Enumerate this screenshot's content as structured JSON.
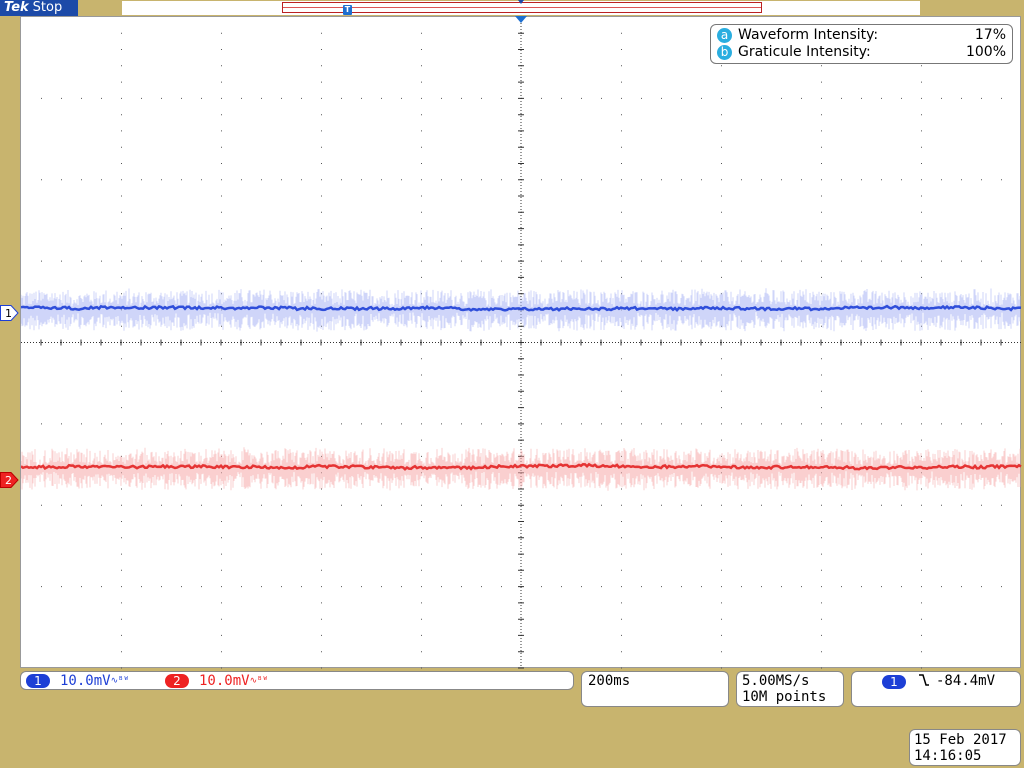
{
  "topbar": {
    "brand": "Tek",
    "state": "Stop",
    "trigger_marker": "T"
  },
  "intensity": {
    "waveform": {
      "key": "a",
      "label": "Waveform Intensity:",
      "value": "17%"
    },
    "graticule": {
      "key": "b",
      "label": "Graticule Intensity:",
      "value": "100%"
    }
  },
  "channel_markers": {
    "ch1": "1",
    "ch2": "2"
  },
  "channels": [
    {
      "number": "1",
      "scale": "10.0mV",
      "coupling": "∿ᴮᵂ",
      "color": "#1d3fd6"
    },
    {
      "number": "2",
      "scale": "10.0mV",
      "coupling": "∿ᴮᵂ",
      "color": "#e22222"
    }
  ],
  "timebase": "200ms",
  "acquisition": {
    "sample_rate": "5.00MS/s",
    "record_length": "10M points"
  },
  "trigger": {
    "source": "1",
    "slope_icon": "falling-edge-icon",
    "slope_glyph": "⌄",
    "level": "-84.4mV"
  },
  "datetime": {
    "date": "15 Feb  2017",
    "time": "14:16:05"
  },
  "colors": {
    "ch1": "#1d3fd6",
    "ch2": "#e22222",
    "bezel": "#c8b46e",
    "brand": "#1c4aa8"
  }
}
